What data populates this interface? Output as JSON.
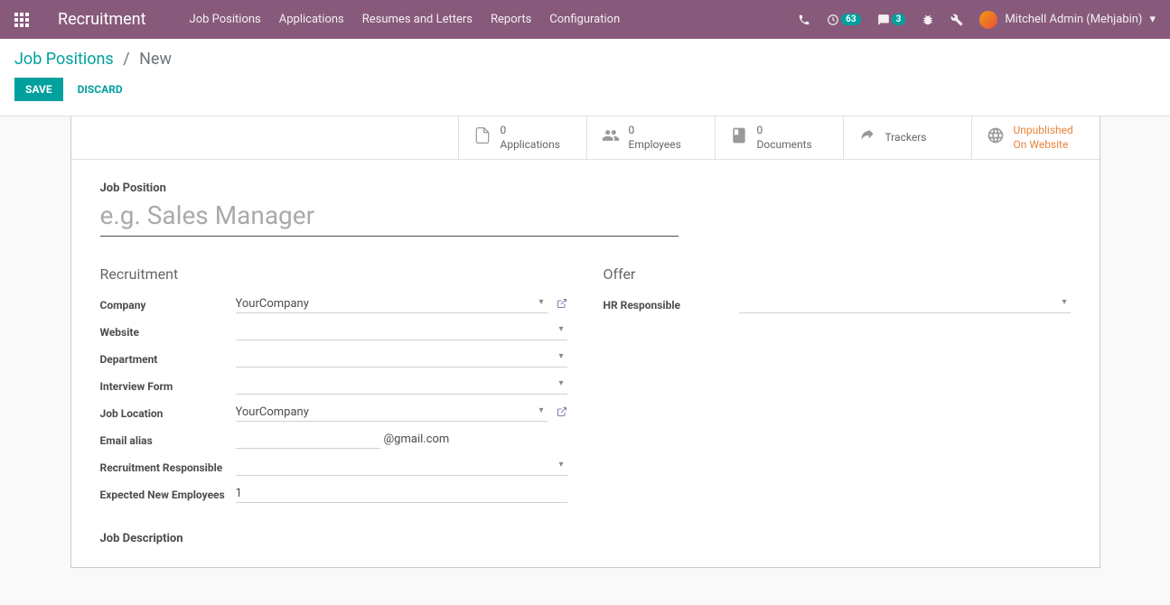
{
  "nav": {
    "title": "Recruitment",
    "links": [
      "Job Positions",
      "Applications",
      "Resumes and Letters",
      "Reports",
      "Configuration"
    ],
    "activities_count": "63",
    "messages_count": "3",
    "user": "Mitchell Admin (Mehjabin)"
  },
  "breadcrumb": {
    "root": "Job Positions",
    "current": "New"
  },
  "buttons": {
    "save": "SAVE",
    "discard": "DISCARD"
  },
  "stats": {
    "applications": {
      "count": "0",
      "label": "Applications"
    },
    "employees": {
      "count": "0",
      "label": "Employees"
    },
    "documents": {
      "count": "0",
      "label": "Documents"
    },
    "trackers": {
      "label": "Trackers"
    },
    "website": {
      "line1": "Unpublished",
      "line2": "On Website"
    }
  },
  "form": {
    "position_label": "Job Position",
    "position_placeholder": "e.g. Sales Manager",
    "recruitment_section": "Recruitment",
    "offer_section": "Offer",
    "labels": {
      "company": "Company",
      "website": "Website",
      "department": "Department",
      "interview_form": "Interview Form",
      "job_location": "Job Location",
      "email_alias": "Email alias",
      "recruitment_responsible": "Recruitment Responsible",
      "expected_new_employees": "Expected New Employees",
      "hr_responsible": "HR Responsible",
      "job_description": "Job Description"
    },
    "values": {
      "company": "YourCompany",
      "job_location": "YourCompany",
      "email_suffix": "@gmail.com",
      "expected_new_employees": "1"
    }
  }
}
